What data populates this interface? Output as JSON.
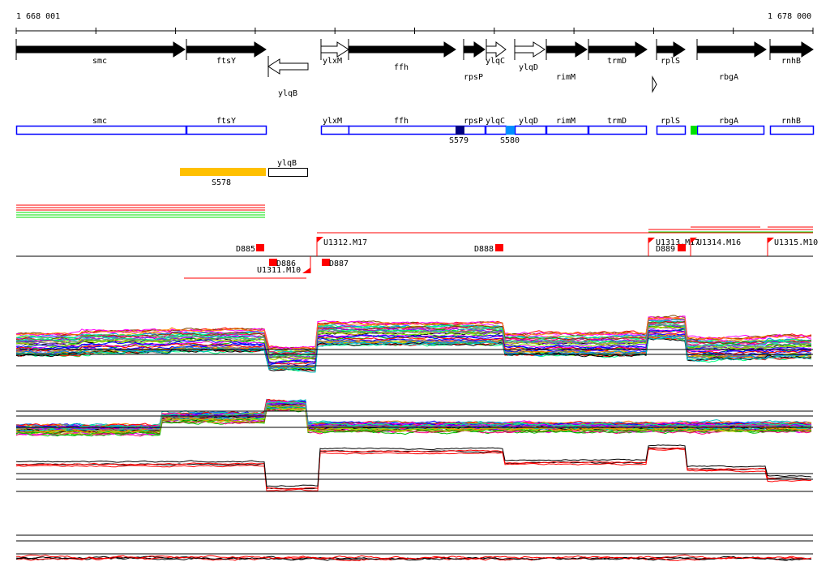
{
  "axis": {
    "start_label": "1 668 001",
    "end_label": "1 678 000"
  },
  "genes": [
    {
      "name": "smc",
      "strand": "+",
      "fill": "black"
    },
    {
      "name": "ftsY",
      "strand": "+",
      "fill": "black"
    },
    {
      "name": "ylqB",
      "strand": "-",
      "fill": "white"
    },
    {
      "name": "ylxM",
      "strand": "+",
      "fill": "white"
    },
    {
      "name": "ffh",
      "strand": "+",
      "fill": "black"
    },
    {
      "name": "rpsP",
      "strand": "+",
      "fill": "black"
    },
    {
      "name": "ylqC",
      "strand": "+",
      "fill": "white"
    },
    {
      "name": "ylqD",
      "strand": "+",
      "fill": "white"
    },
    {
      "name": "rimM",
      "strand": "+",
      "fill": "black"
    },
    {
      "name": "trmD",
      "strand": "+",
      "fill": "black"
    },
    {
      "name": "rplS",
      "strand": "+",
      "fill": "black"
    },
    {
      "name": "rbgA",
      "strand": "+",
      "fill": "black"
    },
    {
      "name": "rnhB",
      "strand": "+",
      "fill": "black"
    }
  ],
  "segments": {
    "S578": "S578",
    "S579": "S579",
    "S580": "S580",
    "ylqB": "ylqB"
  },
  "features": [
    "D885",
    "D886",
    "U1311.M10",
    "U1312.M17",
    "D887",
    "D888",
    "U1313.M17",
    "D889",
    "U1314.M16",
    "U1315.M10"
  ],
  "colors": {
    "gene_box": "#0000ff",
    "S578": "#ffc000",
    "S579": "#000080",
    "S580": "#0090ff",
    "green_seg": "#00e000",
    "marker": "#ff0000"
  }
}
